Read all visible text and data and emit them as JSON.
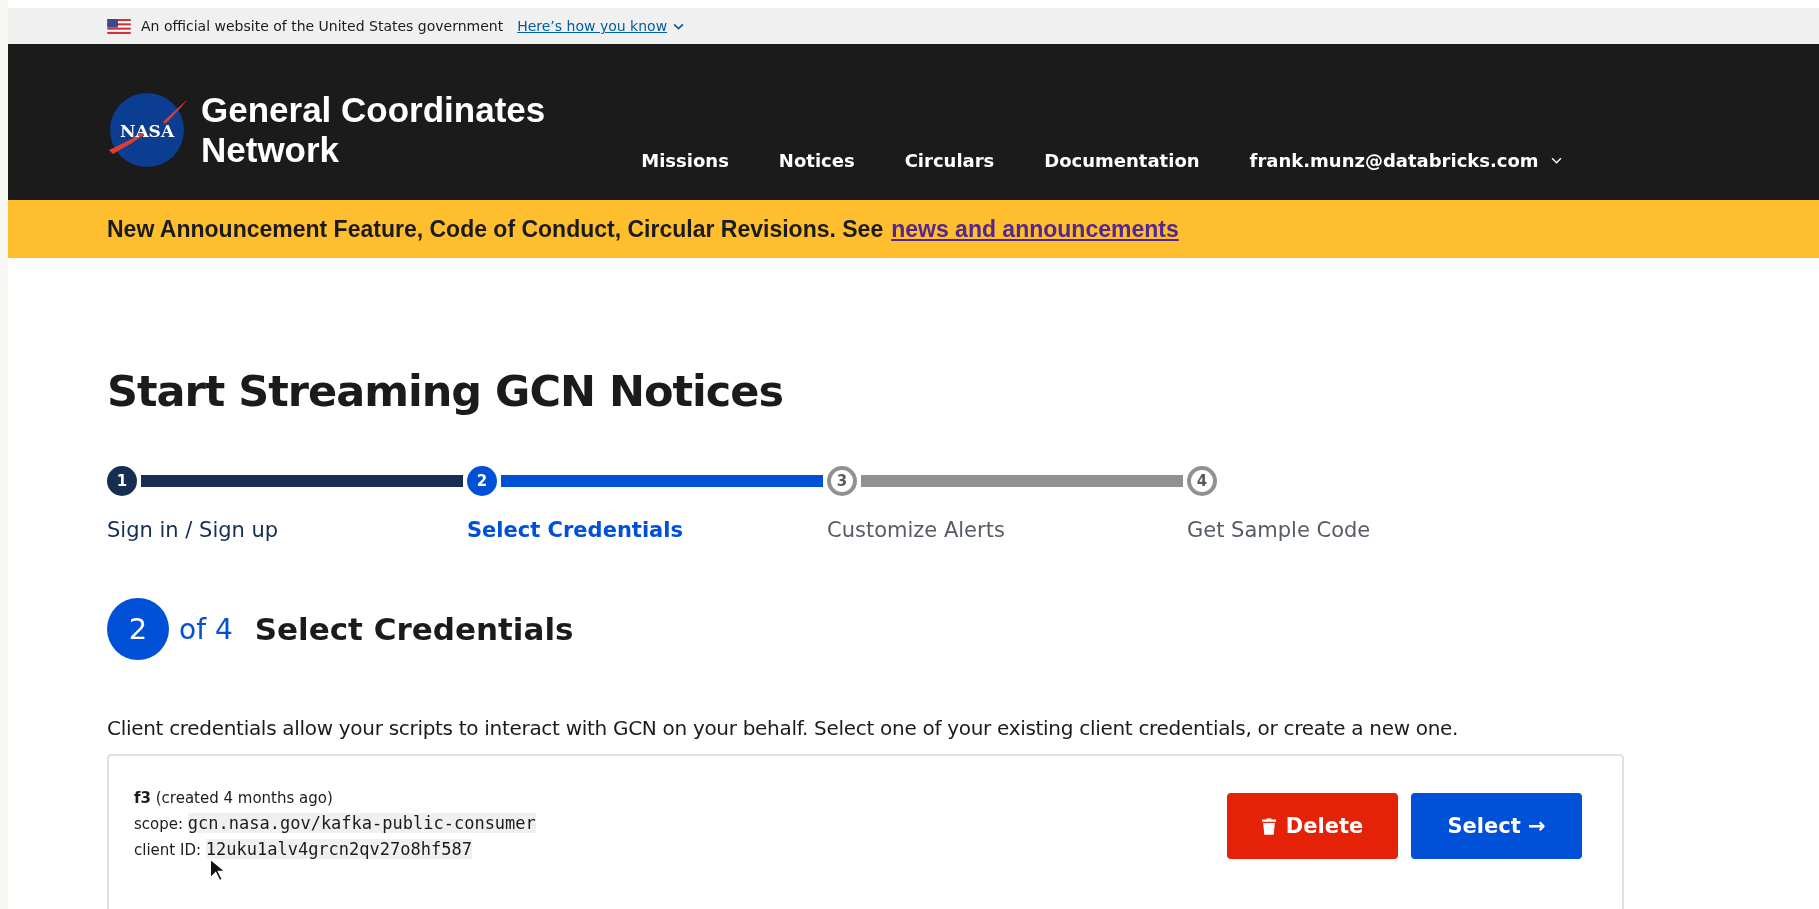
{
  "gov_banner": {
    "text": "An official website of the United States government",
    "link": "Here’s how you know"
  },
  "header": {
    "logo_text": "NASA",
    "title_line1": "General Coordinates",
    "title_line2": "Network",
    "nav": [
      {
        "label": "Missions"
      },
      {
        "label": "Notices"
      },
      {
        "label": "Circulars"
      },
      {
        "label": "Documentation"
      },
      {
        "label": "frank.munz@databricks.com",
        "kind": "menu"
      }
    ]
  },
  "announcement": {
    "text": "New Announcement Feature, Code of Conduct, Circular Revisions. See",
    "link": "news and announcements"
  },
  "page_title": "Start Streaming GCN Notices",
  "steps": [
    {
      "number": "1",
      "label": "Sign in / Sign up",
      "complete": true,
      "current": false
    },
    {
      "number": "2",
      "label": "Select Credentials",
      "complete": false,
      "current": true
    },
    {
      "number": "3",
      "label": "Customize Alerts",
      "complete": false,
      "current": false
    },
    {
      "number": "4",
      "label": "Get Sample Code",
      "complete": false,
      "current": false
    }
  ],
  "step_heading": {
    "number": "2",
    "of": "of 4",
    "title": "Select Credentials"
  },
  "intro": "Client credentials allow your scripts to interact with GCN on your behalf. Select one of your existing client credentials, or create a new one.",
  "credentials": [
    {
      "name": "f3",
      "created": "(created 4 months ago)",
      "scope_label": "scope:",
      "scope": "gcn.nasa.gov/kafka-public-consumer",
      "client_label": "client ID:",
      "client_id": "12uku1alv4grcn2qv27o8hf587",
      "delete": "Delete",
      "select": "Select →"
    }
  ]
}
